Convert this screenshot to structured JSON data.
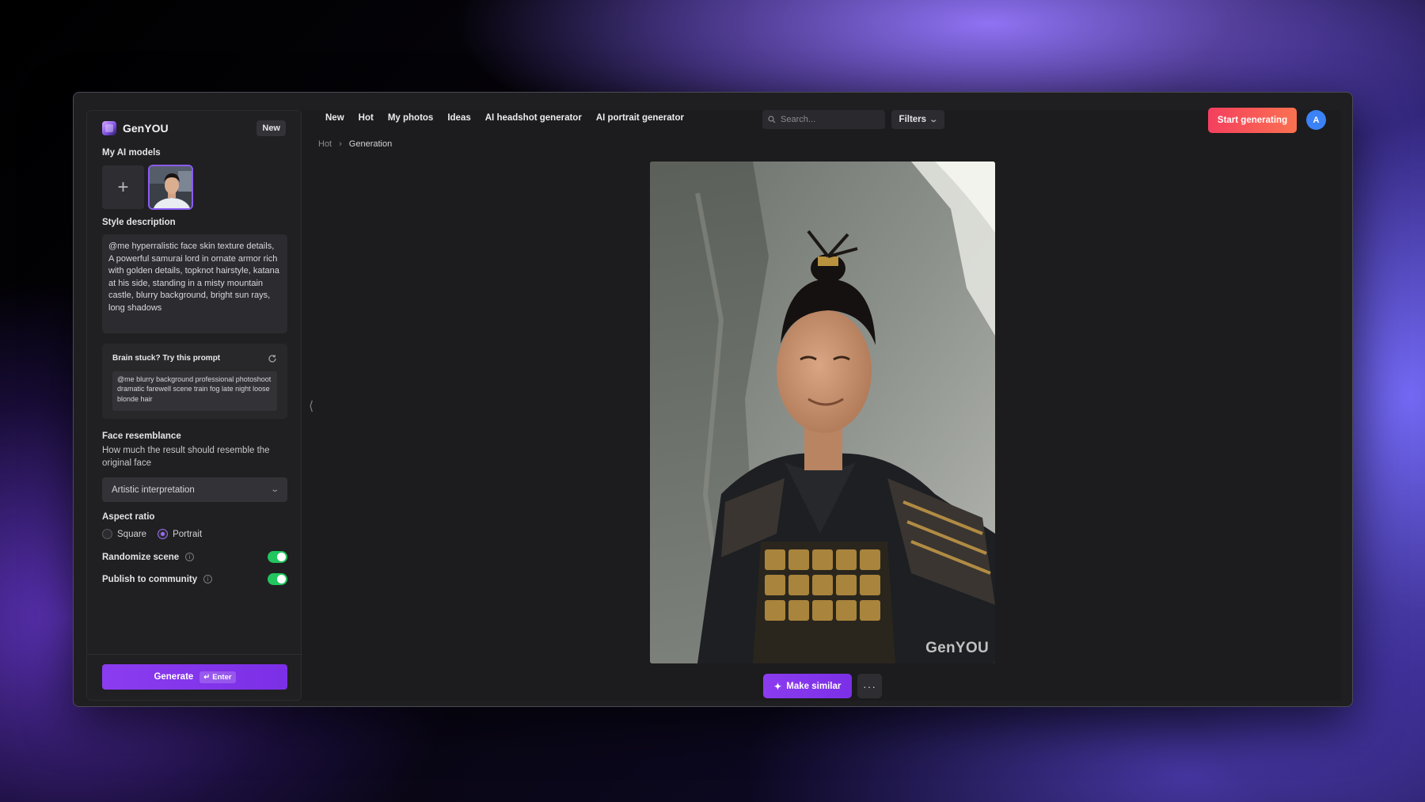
{
  "brand": {
    "name": "GenYOU",
    "badge": "New"
  },
  "sidebar": {
    "models_title": "My AI models",
    "add_model_symbol": "+",
    "style_title": "Style description",
    "style_text": "@me hyperralistic face skin texture details, A powerful samurai lord in ornate armor rich with golden details, topknot hairstyle, katana at his side, standing in a misty mountain castle, blurry  background, bright sun rays, long shadows",
    "prompt_card_title": "Brain stuck? Try this prompt",
    "prompt_suggestion": "@me blurry background professional photoshoot dramatic farewell scene train fog late night loose blonde hair",
    "face_title": "Face resemblance",
    "face_desc": "How much the result should resemble the original face",
    "face_select_value": "Artistic interpretation",
    "aspect_title": "Aspect ratio",
    "aspect_options": [
      "Square",
      "Portrait"
    ],
    "aspect_selected": "Portrait",
    "randomize_label": "Randomize scene",
    "randomize_on": true,
    "publish_label": "Publish to community",
    "publish_on": true,
    "generate_label": "Generate",
    "generate_kbd": "Enter"
  },
  "nav": {
    "items": [
      "New",
      "Hot",
      "My photos",
      "Ideas",
      "AI headshot generator",
      "AI portrait generator"
    ],
    "search_placeholder": "Search...",
    "filters_label": "Filters",
    "start_label": "Start generating",
    "avatar_initial": "A"
  },
  "breadcrumb": {
    "parent": "Hot",
    "current": "Generation"
  },
  "image": {
    "watermark": "GenYOU"
  },
  "actions": {
    "make_similar": "Make similar",
    "more": "···"
  },
  "colors": {
    "accent": "#7b2fe6",
    "start": "#f43f5e",
    "toggle": "#22c55e",
    "avatar": "#3b82f6"
  }
}
